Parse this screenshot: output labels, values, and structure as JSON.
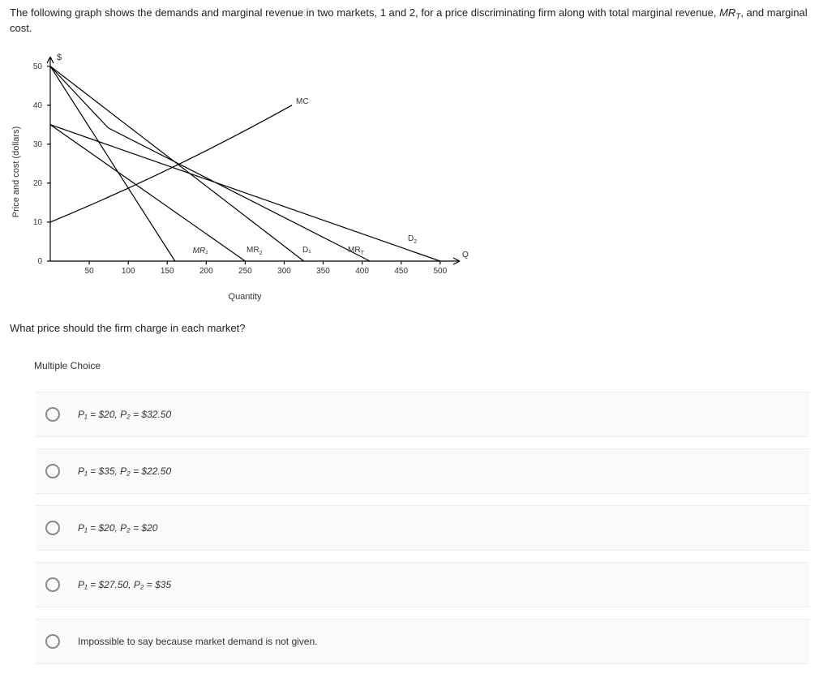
{
  "prompt_prefix": "The following graph shows the demands and marginal revenue in two markets, 1 and 2, for a price discriminating firm along with total marginal revenue, ",
  "prompt_mrt": "MR",
  "prompt_mrt_sub": "T",
  "prompt_suffix": ", and marginal cost.",
  "question2": "What price should the firm charge in each market?",
  "mc_heading": "Multiple Choice",
  "options": {
    "o1": {
      "p1": "P₁ = $20, ",
      "p2": "P₂ = $32.50"
    },
    "o2": {
      "p1": "P₁ = $35, ",
      "p2": "P₂ = $22.50"
    },
    "o3": {
      "p1": "P₁ = $20, ",
      "p2": "P₂ = $20"
    },
    "o4": {
      "p1": "P₁ = $27.50, ",
      "p2": "P₂ = $35"
    },
    "o5": {
      "text": "Impossible to say because market demand is not given."
    }
  },
  "chart_labels": {
    "y_axis": "Price and cost (dollars)",
    "x_axis": "Quantity",
    "dollar": "$",
    "MC": "MC",
    "MR2": "MR",
    "MR2_sub": "2",
    "D1": "D₁",
    "MRT": "MR",
    "MRT_sub": "T",
    "D2": "D₂",
    "Q": "Q"
  },
  "chart_data": {
    "type": "line",
    "title": "",
    "xlabel": "Quantity",
    "ylabel": "Price and cost (dollars)",
    "xlim": [
      0,
      520
    ],
    "ylim": [
      0,
      52
    ],
    "x_ticks": [
      0,
      50,
      100,
      150,
      200,
      250,
      300,
      350,
      400,
      450,
      500
    ],
    "y_ticks": [
      0,
      10,
      20,
      30,
      40,
      50
    ],
    "series": [
      {
        "name": "D1",
        "x": [
          0,
          325
        ],
        "y": [
          50,
          0
        ]
      },
      {
        "name": "MR1",
        "x": [
          0,
          160
        ],
        "y": [
          50,
          0
        ]
      },
      {
        "name": "D2",
        "x": [
          0,
          500
        ],
        "y": [
          35,
          0
        ]
      },
      {
        "name": "MR2",
        "x": [
          0,
          250
        ],
        "y": [
          35,
          0
        ]
      },
      {
        "name": "MRT",
        "x": [
          0,
          70,
          410
        ],
        "y": [
          50,
          35,
          0
        ]
      },
      {
        "name": "MC",
        "x": [
          0,
          310
        ],
        "y": [
          10,
          40
        ]
      }
    ]
  }
}
